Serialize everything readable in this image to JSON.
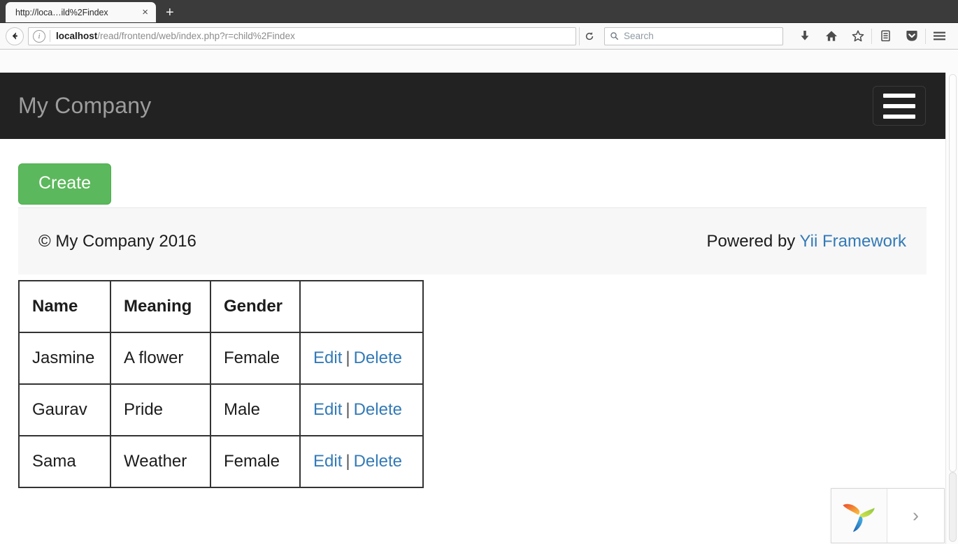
{
  "browser": {
    "tab": {
      "title": "http://loca…ild%2Findex",
      "close_label": "×"
    },
    "new_tab_label": "+",
    "back_icon": "←",
    "forward_icon": "→",
    "info_icon": "i",
    "url": {
      "host": "localhost",
      "path": "/read/frontend/web/index.php?r=child%2Findex",
      "full": "localhost/read/frontend/web/index.php?r=child%2Findex"
    },
    "reload_icon": "⟳",
    "search": {
      "placeholder": "Search",
      "icon": "search-icon",
      "value": ""
    },
    "toolbar_icons": [
      {
        "name": "downloads-icon",
        "glyph": "⬇"
      },
      {
        "name": "home-icon",
        "glyph": "⌂"
      },
      {
        "name": "bookmark-star-icon",
        "glyph": "☆"
      },
      {
        "name": "library-icon",
        "glyph": "▤"
      },
      {
        "name": "pocket-icon",
        "glyph": "▼"
      },
      {
        "name": "menu-hamburger-icon",
        "glyph": "≡"
      }
    ]
  },
  "site": {
    "brand": "My Company",
    "nav_toggle_label": "Toggle navigation",
    "create_button": "Create",
    "footer": {
      "copyright": "© My Company 2016",
      "powered_prefix": "Powered by ",
      "powered_link": "Yii Framework"
    },
    "table": {
      "columns": [
        "Name",
        "Meaning",
        "Gender",
        ""
      ],
      "rows": [
        {
          "name": "Jasmine",
          "meaning": "A flower",
          "gender": "Female",
          "edit": "Edit",
          "separator": "|",
          "delete": "Delete"
        },
        {
          "name": "Gaurav",
          "meaning": "Pride",
          "gender": "Male",
          "edit": "Edit",
          "separator": "|",
          "delete": "Delete"
        },
        {
          "name": "Sama",
          "meaning": "Weather",
          "gender": "Female",
          "edit": "Edit",
          "separator": "|",
          "delete": "Delete"
        }
      ]
    }
  },
  "widget": {
    "logo_name": "zoho-petals-logo",
    "expand_label": "›"
  },
  "colors": {
    "navbar_bg": "#222222",
    "brand_text": "#9d9d9d",
    "create_green": "#5cb85c",
    "link_blue": "#337ab7",
    "footer_bg": "#f7f7f7"
  }
}
